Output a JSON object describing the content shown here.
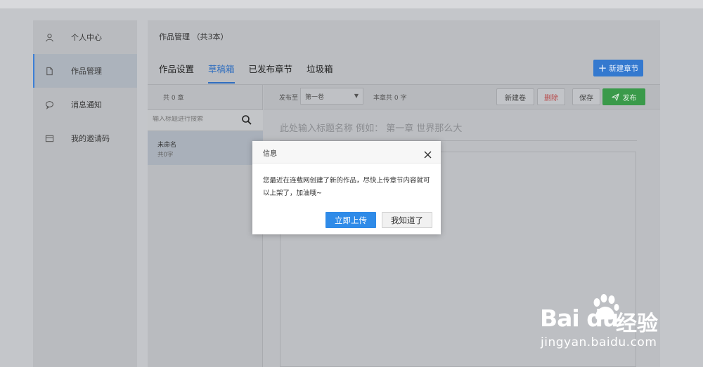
{
  "sidebar": {
    "items": [
      {
        "label": "个人中心",
        "icon": "user-icon",
        "active": false
      },
      {
        "label": "作品管理",
        "icon": "document-icon",
        "active": true
      },
      {
        "label": "消息通知",
        "icon": "chat-bubble-icon",
        "active": false
      },
      {
        "label": "我的邀请码",
        "icon": "card-icon",
        "active": false
      }
    ]
  },
  "main": {
    "title": "作品管理 （共3本）",
    "tabs": [
      "作品设置",
      "草稿箱",
      "已发布章节",
      "垃圾箱"
    ],
    "active_tab": "草稿箱",
    "new_chapter_label": "新建章节"
  },
  "list": {
    "count": "共 0 章",
    "search_placeholder": "输入标题进行搜索",
    "drafts": [
      {
        "name": "未命名",
        "words": "共0字"
      }
    ]
  },
  "editor": {
    "publish_to_label": "发布至",
    "volume": "第一卷",
    "chapter_words": "本章共 0 字",
    "new_volume_label": "新建卷",
    "delete_label": "删除",
    "save_label": "保存",
    "publish_label": "发布",
    "title_placeholder": "此处输入标题名称 例如： 第一章 世界那么大"
  },
  "dialog": {
    "title": "信息",
    "message": "您最近在连载网创建了新的作品，尽快上传章节内容就可以上架了，加油哦~",
    "primary_label": "立即上传",
    "secondary_label": "我知道了"
  },
  "watermark": {
    "logo": "Bai du",
    "cn": "经验",
    "url": "jingyan.baidu.com"
  },
  "colors": {
    "accent": "#2f8be8",
    "publish_green": "#3a9a4a",
    "delete_red": "#b84a4a"
  }
}
